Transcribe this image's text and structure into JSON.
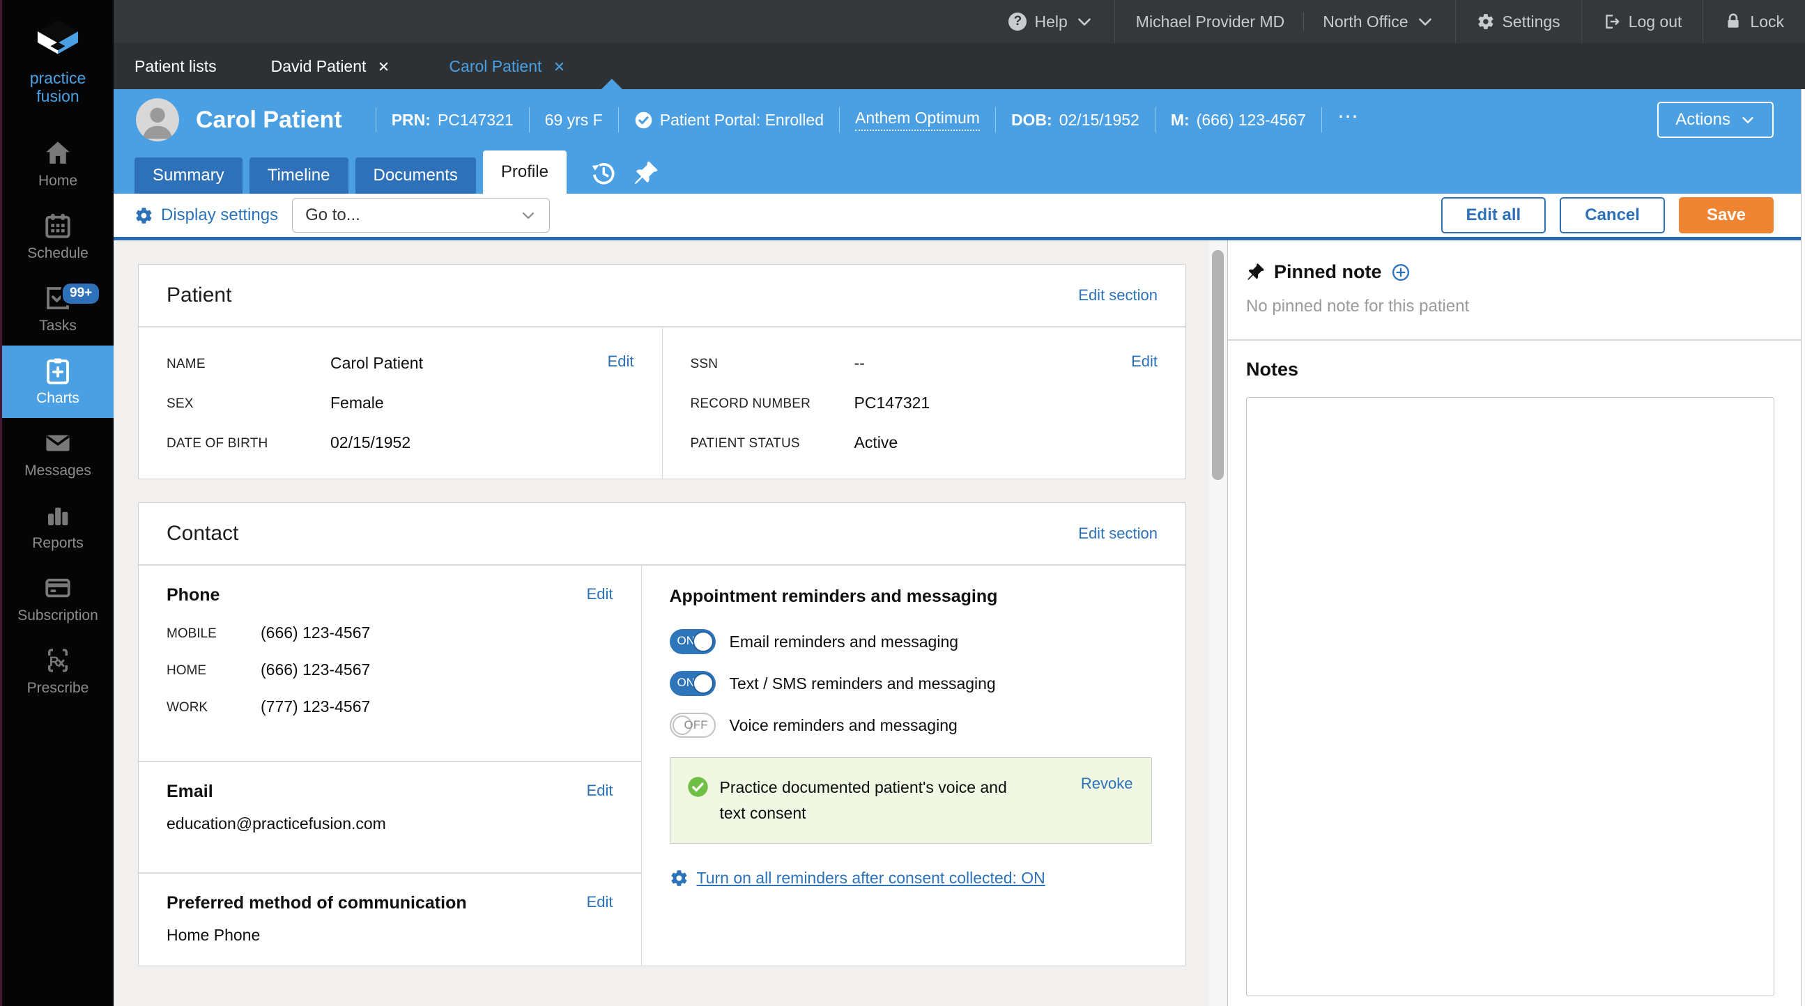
{
  "colors": {
    "accent_blue": "#4AA0E2",
    "dark_blue": "#2E71B8",
    "link_blue": "#2B72B8",
    "save_orange": "#EF8433",
    "topbar_bg": "#34383B",
    "sidebar_bg": "#050505",
    "consent_green_bg": "#F0F7E2",
    "consent_green_icon": "#6FBF44"
  },
  "icons": {
    "help_glyph": "?",
    "more_glyph": "⋯"
  },
  "topbar": {
    "help": "Help",
    "provider": "Michael Provider MD",
    "office": "North Office",
    "settings": "Settings",
    "logout": "Log out",
    "lock": "Lock"
  },
  "tabbar": {
    "patient_lists": "Patient lists",
    "tab_david": "David Patient",
    "tab_carol": "Carol Patient"
  },
  "patient_header": {
    "name": "Carol Patient",
    "prn_label": "PRN:",
    "prn_value": "PC147321",
    "age_sex": "69 yrs F",
    "portal_status": "Patient Portal: Enrolled",
    "insurance": "Anthem Optimum",
    "dob_label": "DOB:",
    "dob_value": "02/15/1952",
    "mobile_label": "M:",
    "mobile_value": "(666) 123-4567",
    "actions_label": "Actions"
  },
  "chart_tabs": {
    "summary": "Summary",
    "timeline": "Timeline",
    "documents": "Documents",
    "profile": "Profile"
  },
  "toolbar": {
    "display_settings": "Display settings",
    "goto_placeholder": "Go to...",
    "edit_all": "Edit all",
    "cancel": "Cancel",
    "save": "Save"
  },
  "sidebar": {
    "logo_line1": "practice",
    "logo_line2": "fusion",
    "items": [
      {
        "label": "Home"
      },
      {
        "label": "Schedule"
      },
      {
        "label": "Tasks",
        "badge": "99+"
      },
      {
        "label": "Charts"
      },
      {
        "label": "Messages"
      },
      {
        "label": "Reports"
      },
      {
        "label": "Subscription"
      },
      {
        "label": "Prescribe"
      }
    ]
  },
  "patient_card": {
    "title": "Patient",
    "edit_section": "Edit section",
    "edit": "Edit",
    "left": {
      "rows": [
        {
          "label": "NAME",
          "value": "Carol Patient"
        },
        {
          "label": "SEX",
          "value": "Female"
        },
        {
          "label": "DATE OF BIRTH",
          "value": "02/15/1952"
        }
      ]
    },
    "right": {
      "rows": [
        {
          "label": "SSN",
          "value": "--"
        },
        {
          "label": "RECORD NUMBER",
          "value": "PC147321"
        },
        {
          "label": "PATIENT STATUS",
          "value": "Active"
        }
      ]
    }
  },
  "contact_card": {
    "title": "Contact",
    "edit_section": "Edit section",
    "edit": "Edit",
    "phone": {
      "heading": "Phone",
      "rows": [
        {
          "label": "MOBILE",
          "value": "(666) 123-4567"
        },
        {
          "label": "HOME",
          "value": "(666) 123-4567"
        },
        {
          "label": "WORK",
          "value": "(777) 123-4567"
        }
      ]
    },
    "email": {
      "heading": "Email",
      "value": "education@practicefusion.com"
    },
    "preferred": {
      "heading": "Preferred method of communication",
      "value": "Home Phone"
    },
    "reminders": {
      "heading": "Appointment reminders and messaging",
      "toggles": [
        {
          "state": "ON",
          "label": "Email reminders and messaging"
        },
        {
          "state": "ON",
          "label": "Text / SMS reminders and messaging"
        },
        {
          "state": "OFF",
          "label": "Voice reminders and messaging"
        }
      ],
      "consent_text": "Practice documented patient's voice and text consent",
      "revoke": "Revoke",
      "consent_link": "Turn on all reminders after consent collected: ON"
    }
  },
  "right_panel": {
    "pinned_note_title": "Pinned note",
    "pinned_note_empty": "No pinned note for this patient",
    "notes_title": "Notes",
    "notes_value": ""
  }
}
